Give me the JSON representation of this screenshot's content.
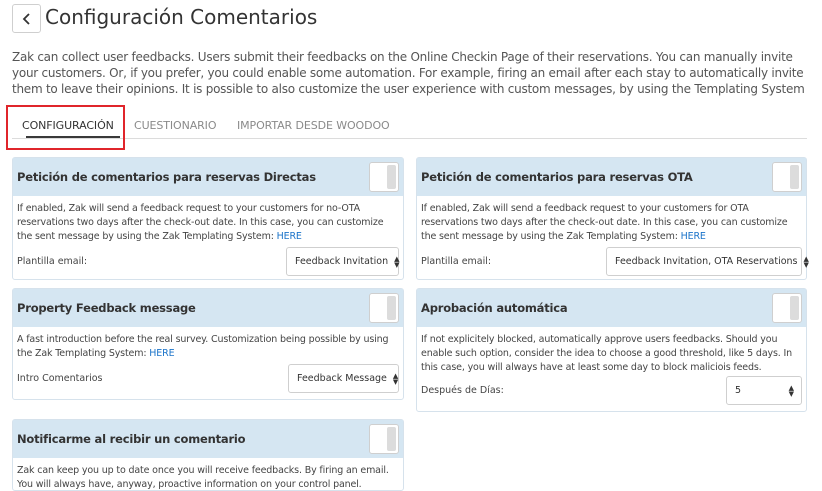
{
  "header": {
    "title": "Configuración Comentarios",
    "back_icon": "chevron-left-icon"
  },
  "intro_text": "Zak can collect user feedbacks. Users submit their feedbacks on the Online Checkin Page of their reservations. You can manually invite your customers. Or, if you prefer, you could enable some automation. For example, firing an email after each stay to automatically invite them to leave their opinions. It is possible to also customize the user experience with custom messages, by using the Templating System",
  "tabs": [
    {
      "label": "CONFIGURACIÓN",
      "active": true
    },
    {
      "label": "CUESTIONARIO",
      "active": false
    },
    {
      "label": "IMPORTAR DESDE WOODOO",
      "active": false
    }
  ],
  "colors": {
    "card_header_bg": "#d5e6f2",
    "link": "#1a73c9",
    "highlight_box": "#e0252b"
  },
  "cards": {
    "direct": {
      "title": "Petición de comentarios para reservas Directas",
      "desc": "If enabled, Zak will send a feedback request to your customers for no-OTA reservations two days after the check-out date. In this case, you can customize the sent message by using the Zak Templating System:",
      "link": "HERE",
      "field_label": "Plantilla email:",
      "select_value": "Feedback Invitation"
    },
    "ota": {
      "title": "Petición de comentarios para reservas OTA",
      "desc": "If enabled, Zak will send a feedback request to your customers for OTA reservations two days after the check-out date. In this case, you can customize the sent message by using the Zak Templating System:",
      "link": "HERE",
      "field_label": "Plantilla email:",
      "select_value": "Feedback Invitation, OTA Reservations"
    },
    "property": {
      "title": "Property Feedback message",
      "desc": "A fast introduction before the real survey. Customization being possible by using the Zak Templating System:",
      "link": "HERE",
      "field_label": "Intro Comentarios",
      "select_value": "Feedback Message"
    },
    "approval": {
      "title": "Aprobación automática",
      "desc": "If not explicitely blocked, automatically approve users feedbacks. Should you enable such option, consider the idea to choose a good threshold, like 5 days. In this case, you will always have at least some day to block maliciois feeds.",
      "field_label": "Después de Días:",
      "select_value": "5"
    },
    "notify": {
      "title": "Notificarme al recibir un comentario",
      "desc": "Zak can keep you up to date once you will receive feedbacks. By firing an email. You will always have, anyway, proactive information on your control panel."
    }
  }
}
